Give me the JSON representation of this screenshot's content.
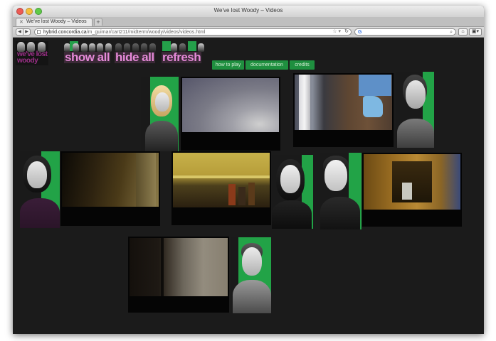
{
  "window": {
    "title": "We've lost Woody – Videos"
  },
  "tabs": [
    {
      "label": "We've lost Woody – Videos"
    }
  ],
  "toolbar": {
    "url_host": "hybrid.concordia.ca",
    "url_path": "/m_guimar/cart211/midterm/woody/videos/videos.html",
    "search_placeholder": ""
  },
  "site": {
    "logo_text": "we've lost woody",
    "buttons": {
      "show_all": "show all",
      "hide_all": "hide all",
      "refresh": "refresh"
    },
    "nav": [
      {
        "label": "how to play"
      },
      {
        "label": "documentation"
      },
      {
        "label": "credits"
      }
    ]
  },
  "colors": {
    "background": "#1b1b1b",
    "accent_green": "#22a347",
    "accent_pink": "#e58ad8",
    "logo_purple": "#9a2f86"
  },
  "icons": {
    "back": "chevron-left-icon",
    "forward": "chevron-right-icon",
    "bookmark": "star-icon",
    "reload": "reload-icon",
    "search": "magnifier-icon",
    "home": "home-icon"
  }
}
